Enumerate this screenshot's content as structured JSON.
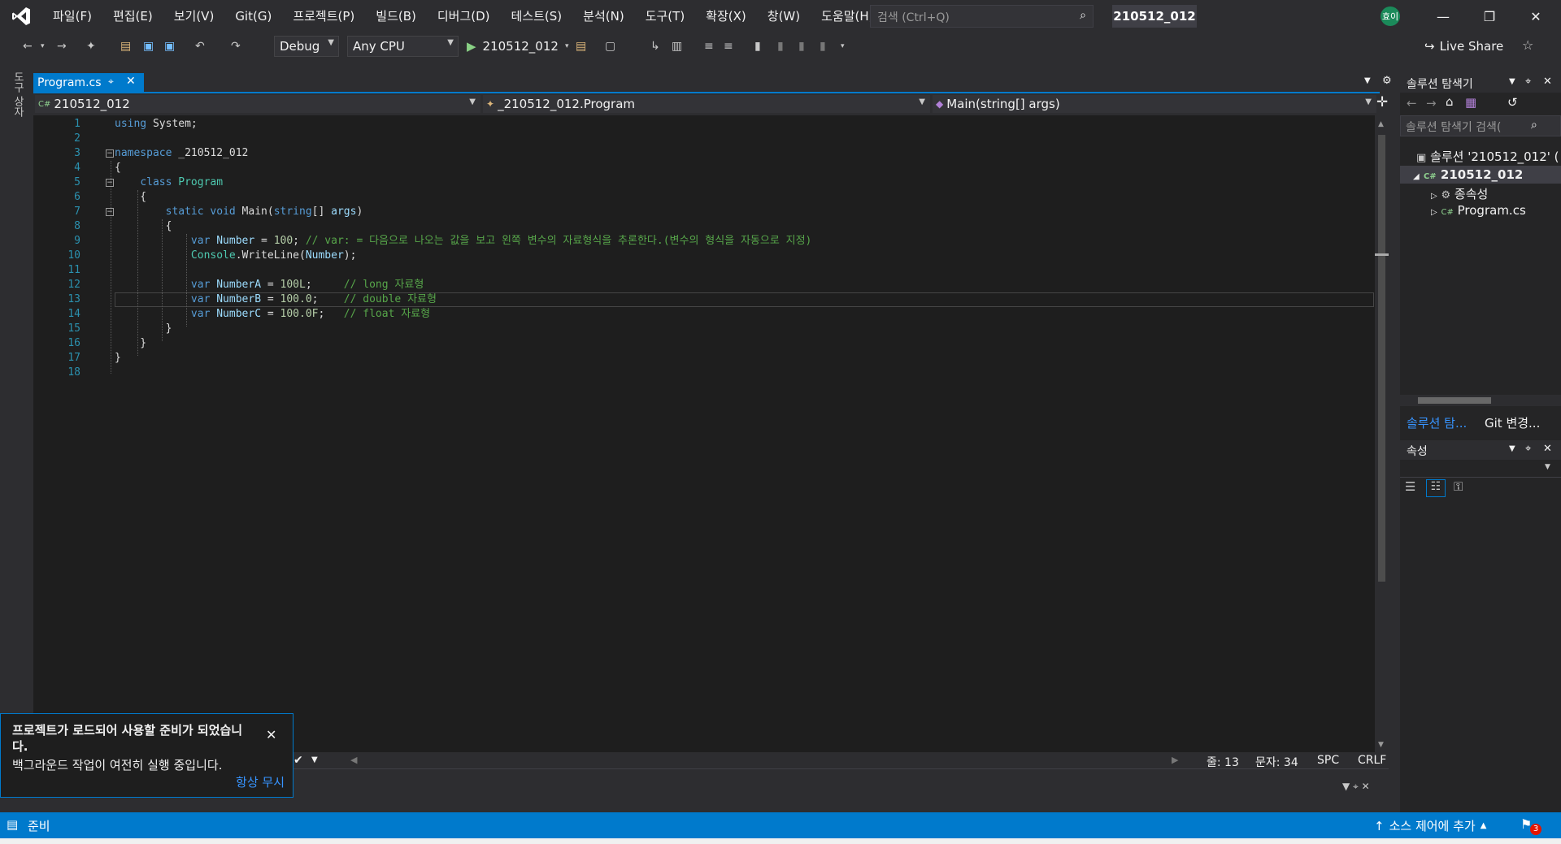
{
  "window": {
    "menus": [
      "파일(F)",
      "편집(E)",
      "보기(V)",
      "Git(G)",
      "프로젝트(P)",
      "빌드(B)",
      "디버그(D)",
      "테스트(S)",
      "분석(N)",
      "도구(T)",
      "확장(X)",
      "창(W)",
      "도움말(H)"
    ],
    "search_placeholder": "검색 (Ctrl+Q)",
    "solution_title": "210512_012",
    "avatar_initials": "효이"
  },
  "toolbar": {
    "config": "Debug",
    "platform": "Any CPU",
    "run_target": "210512_012",
    "live_share": "Live Share"
  },
  "left_strip": {
    "label": "도구 상자"
  },
  "document_tab": {
    "name": "Program.cs"
  },
  "navbar": {
    "project": "210512_012",
    "class": "_210512_012.Program",
    "member": "Main(string[] args)"
  },
  "code_lines": [
    "using System;",
    "",
    "namespace _210512_012",
    "{",
    "    class Program",
    "    {",
    "        static void Main(string[] args)",
    "        {",
    "            var Number = 100; // var: = 다음으로 나오는 값을 보고 왼쪽 변수의 자료형식을 추론한다.(변수의 형식을 자동으로 지정)",
    "            Console.WriteLine(Number);",
    "",
    "            var NumberA = 100L;     // long 자료형",
    "            var NumberB = 100.0;    // double 자료형",
    "            var NumberC = 100.0F;   // float 자료형",
    "        }",
    "    }",
    "}",
    ""
  ],
  "editor_status": {
    "zoom_icon": "code-health-icon",
    "line": "줄: 13",
    "column": "문자: 34",
    "spacing": "SPC",
    "line_ending": "CRLF"
  },
  "solution_explorer": {
    "title": "솔루션 탐색기",
    "search_placeholder": "솔루션 탐색기 검색(",
    "solution_node": "솔루션 '210512_012' (",
    "project_node": "210512_012",
    "dependencies_node": "종속성",
    "file_node": "Program.cs",
    "tab_solution": "솔루션 탐...",
    "tab_git": "Git 변경..."
  },
  "properties": {
    "title": "속성"
  },
  "toast": {
    "title": "프로젝트가 로드되어 사용할 준비가 되었습니다.",
    "body": "백그라운드 작업이 여전히 실행 중입니다.",
    "action": "항상 무시"
  },
  "statusbar": {
    "ready": "준비",
    "source_control": "소스 제어에 추가",
    "notifications": "3"
  },
  "colors": {
    "accent": "#007acc",
    "background": "#2d2d30",
    "editor": "#1e1e1e"
  }
}
